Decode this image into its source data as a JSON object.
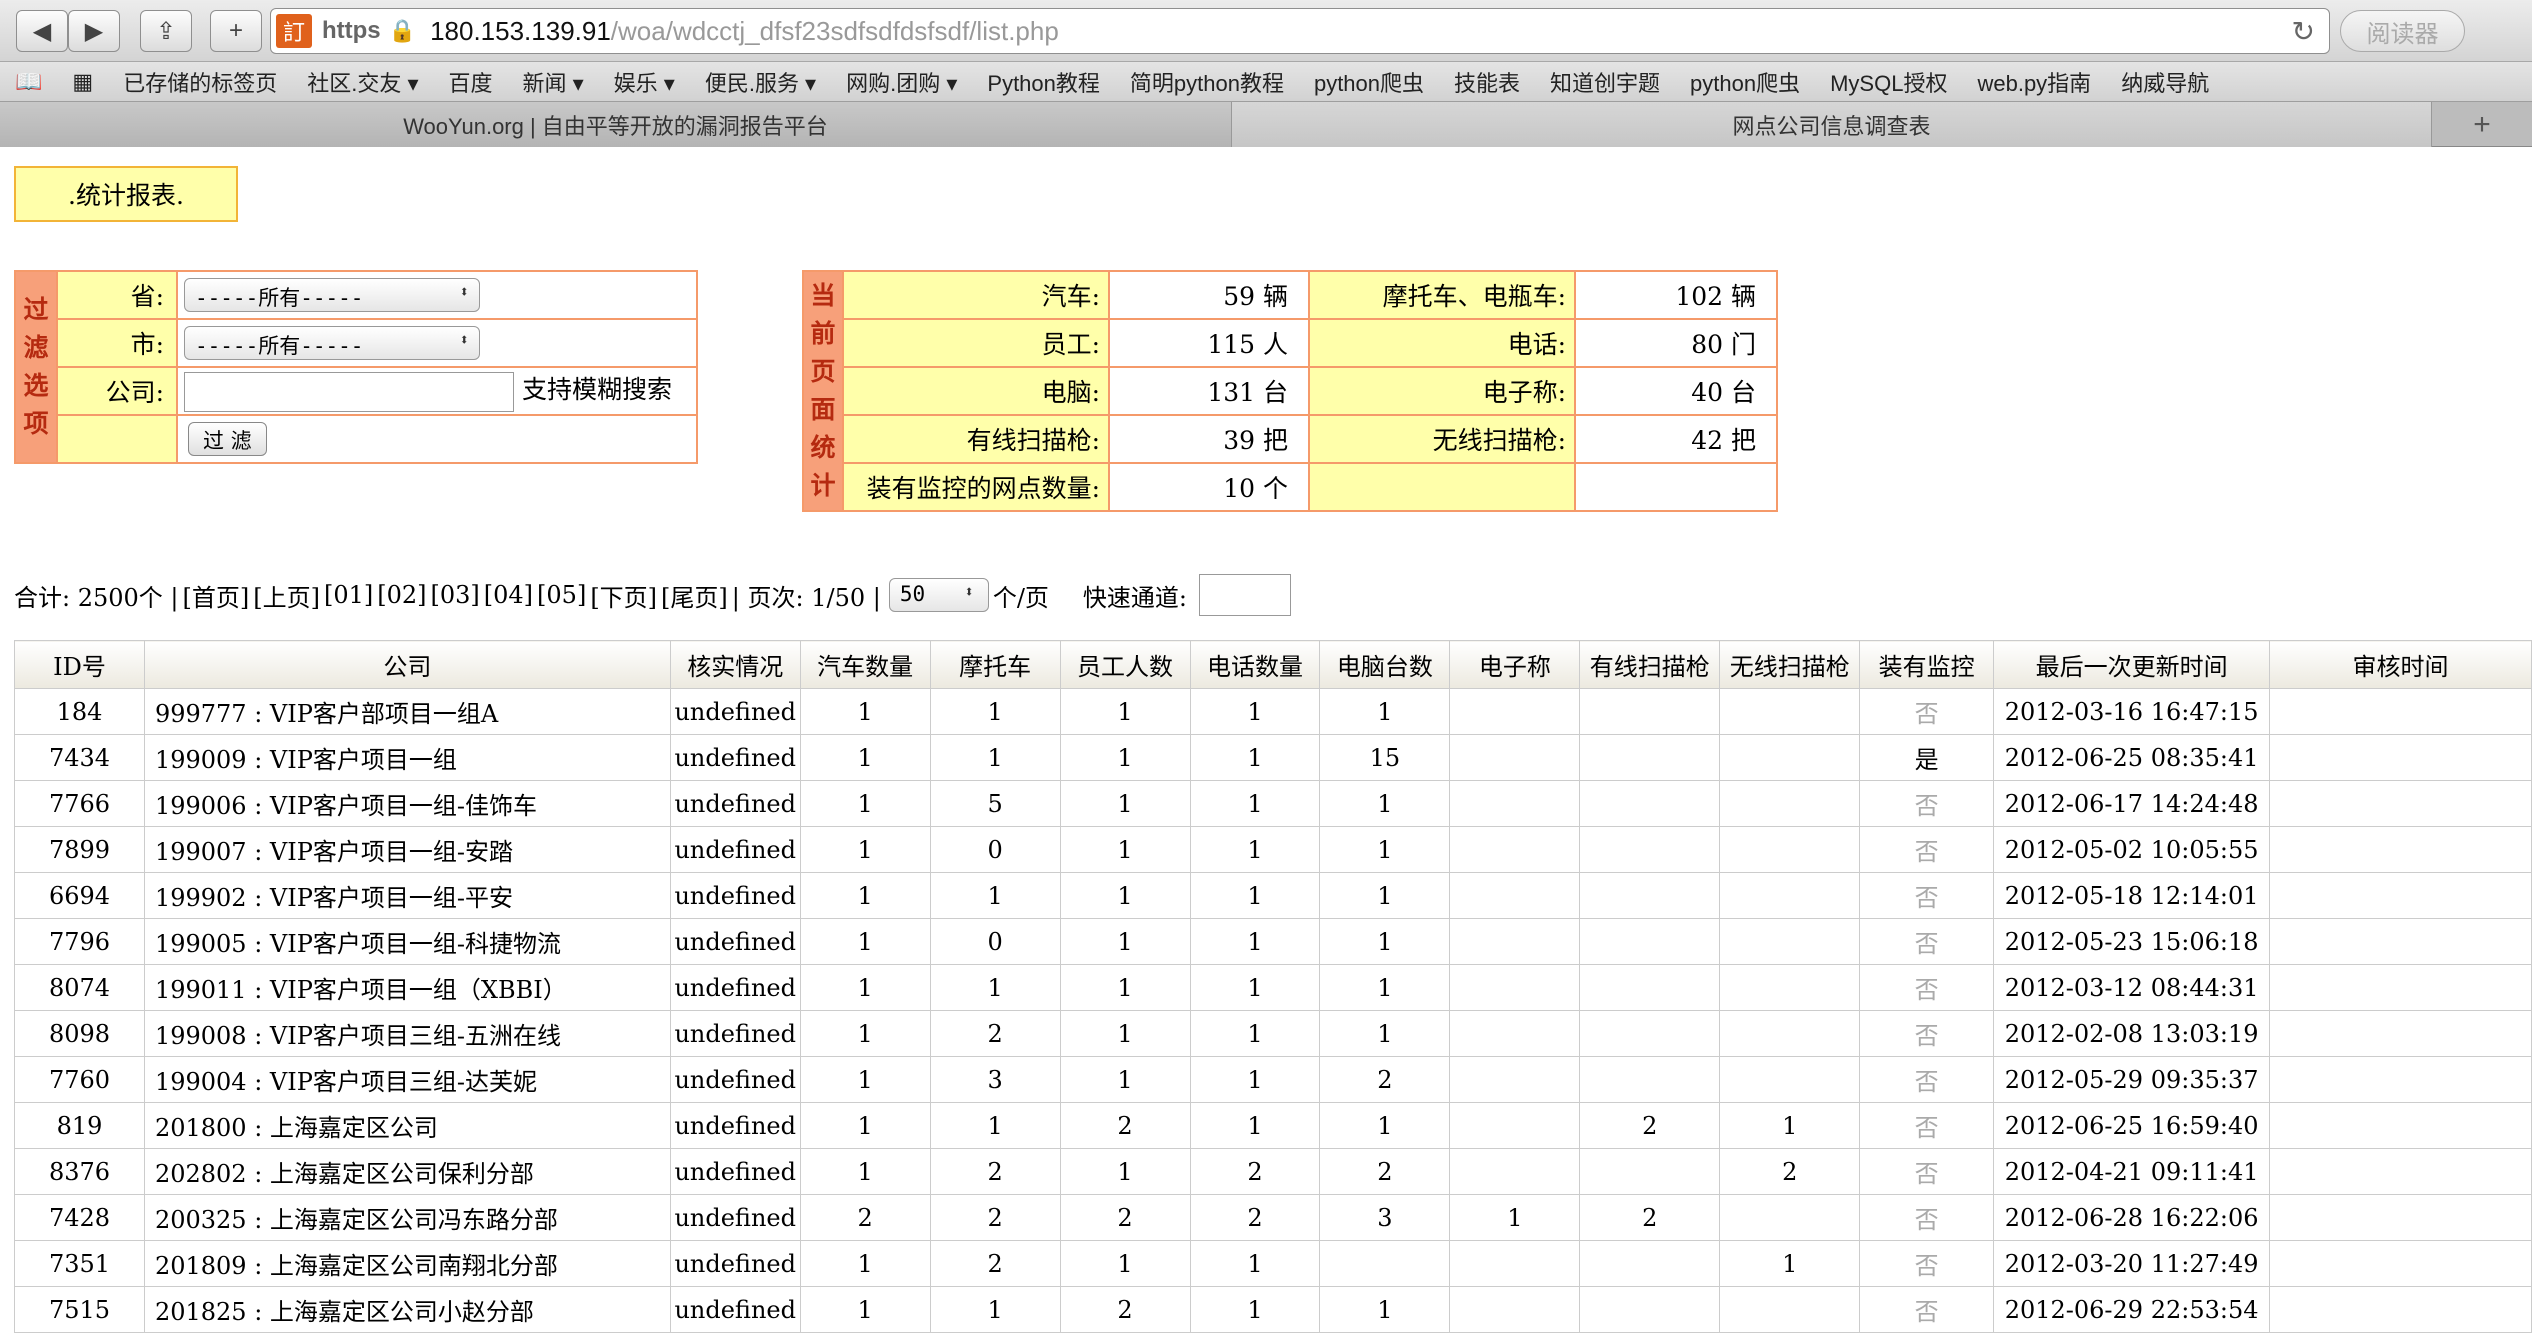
{
  "browser": {
    "protocol": "https",
    "host": "180.153.139.91",
    "path": "/woa/wdcctj_dfsf23sdfsdfdsfsdf/list.php",
    "reader_label": "阅读器",
    "fav_glyph": "訂"
  },
  "bookmarks": [
    "已存储的标签页",
    "社区.交友 ▾",
    "百度",
    "新闻 ▾",
    "娱乐 ▾",
    "便民.服务 ▾",
    "网购.团购 ▾",
    "Python教程",
    "简明python教程",
    "python爬虫",
    "技能表",
    "知道创宇题",
    "python爬虫",
    "MySQL授权",
    "web.py指南",
    "纳威导航"
  ],
  "tabs": [
    "WooYun.org | 自由平等开放的漏洞报告平台",
    "网点公司信息调查表"
  ],
  "report_title": ".统计报表.",
  "filter": {
    "side_label": "过滤选项",
    "province_label": "省:",
    "province_value": "-----所有-----",
    "city_label": "市:",
    "city_value": "-----所有-----",
    "company_label": "公司:",
    "fuzzy_hint": "支持模糊搜索",
    "filter_button": "过 滤"
  },
  "stats": {
    "side_label": "当前页面统计",
    "car_label": "汽车:",
    "car_value": "59 辆",
    "moto_label": "摩托车、电瓶车:",
    "moto_value": "102 辆",
    "staff_label": "员工:",
    "staff_value": "115 人",
    "phone_label": "电话:",
    "phone_value": "80 门",
    "pc_label": "电脑:",
    "pc_value": "131 台",
    "scale_label": "电子称:",
    "scale_value": "40 台",
    "wired_label": "有线扫描枪:",
    "wired_value": "39 把",
    "wireless_label": "无线扫描枪:",
    "wireless_value": "42 把",
    "monitor_label": "装有监控的网点数量:",
    "monitor_value": "10 个"
  },
  "pager": {
    "total": "合计: 2500个 |",
    "first": "[首页]",
    "prev": "[上页]",
    "p1": "[01]",
    "p2": "[02]",
    "p3": "[03]",
    "p4": "[04]",
    "p5": "[05]",
    "next": "[下页]",
    "last": "[尾页]",
    "pageinfo": "| 页次: 1/50 |",
    "per_page": "50",
    "per_page_unit": "个/页",
    "quick": "快速通道:"
  },
  "table": {
    "headers": [
      "ID号",
      "公司",
      "核实情况",
      "汽车数量",
      "摩托车",
      "员工人数",
      "电话数量",
      "电脑台数",
      "电子称",
      "有线扫描枪",
      "无线扫描枪",
      "装有监控",
      "最后一次更新时间",
      "审核时间"
    ],
    "rows": [
      [
        "184",
        "999777 : VIP客户部项目一组A",
        "undefined",
        "1",
        "1",
        "1",
        "1",
        "1",
        "",
        "",
        "",
        "否",
        "2012-03-16 16:47:15",
        ""
      ],
      [
        "7434",
        "199009 : VIP客户项目一组",
        "undefined",
        "1",
        "1",
        "1",
        "1",
        "15",
        "",
        "",
        "",
        "是",
        "2012-06-25 08:35:41",
        ""
      ],
      [
        "7766",
        "199006 : VIP客户项目一组-佳饰车",
        "undefined",
        "1",
        "5",
        "1",
        "1",
        "1",
        "",
        "",
        "",
        "否",
        "2012-06-17 14:24:48",
        ""
      ],
      [
        "7899",
        "199007 : VIP客户项目一组-安踏",
        "undefined",
        "1",
        "0",
        "1",
        "1",
        "1",
        "",
        "",
        "",
        "否",
        "2012-05-02 10:05:55",
        ""
      ],
      [
        "6694",
        "199902 : VIP客户项目一组-平安",
        "undefined",
        "1",
        "1",
        "1",
        "1",
        "1",
        "",
        "",
        "",
        "否",
        "2012-05-18 12:14:01",
        ""
      ],
      [
        "7796",
        "199005 : VIP客户项目一组-科捷物流",
        "undefined",
        "1",
        "0",
        "1",
        "1",
        "1",
        "",
        "",
        "",
        "否",
        "2012-05-23 15:06:18",
        ""
      ],
      [
        "8074",
        "199011 : VIP客户项目一组（XBBI）",
        "undefined",
        "1",
        "1",
        "1",
        "1",
        "1",
        "",
        "",
        "",
        "否",
        "2012-03-12 08:44:31",
        ""
      ],
      [
        "8098",
        "199008 : VIP客户项目三组-五洲在线",
        "undefined",
        "1",
        "2",
        "1",
        "1",
        "1",
        "",
        "",
        "",
        "否",
        "2012-02-08 13:03:19",
        ""
      ],
      [
        "7760",
        "199004 : VIP客户项目三组-达芙妮",
        "undefined",
        "1",
        "3",
        "1",
        "1",
        "2",
        "",
        "",
        "",
        "否",
        "2012-05-29 09:35:37",
        ""
      ],
      [
        "819",
        "201800 : 上海嘉定区公司",
        "undefined",
        "1",
        "1",
        "2",
        "1",
        "1",
        "",
        "2",
        "1",
        "否",
        "2012-06-25 16:59:40",
        ""
      ],
      [
        "8376",
        "202802 : 上海嘉定区公司保利分部",
        "undefined",
        "1",
        "2",
        "1",
        "2",
        "2",
        "",
        "",
        "2",
        "否",
        "2012-04-21 09:11:41",
        ""
      ],
      [
        "7428",
        "200325 : 上海嘉定区公司冯东路分部",
        "undefined",
        "2",
        "2",
        "2",
        "2",
        "3",
        "1",
        "2",
        "",
        "否",
        "2012-06-28 16:22:06",
        ""
      ],
      [
        "7351",
        "201809 : 上海嘉定区公司南翔北分部",
        "undefined",
        "1",
        "2",
        "1",
        "1",
        "",
        "",
        "",
        "1",
        "否",
        "2012-03-20 11:27:49",
        ""
      ],
      [
        "7515",
        "201825 : 上海嘉定区公司小赵分部",
        "undefined",
        "1",
        "1",
        "2",
        "1",
        "1",
        "",
        "",
        "",
        "否",
        "2012-06-29 22:53:54",
        ""
      ]
    ]
  }
}
